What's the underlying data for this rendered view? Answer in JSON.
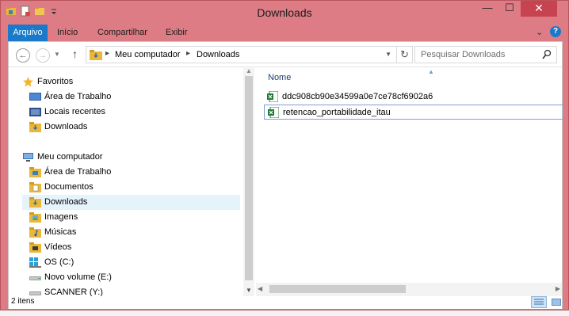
{
  "window": {
    "title": "Downloads",
    "controls": {
      "minimize": "—",
      "maximize": "☐",
      "close": "✕"
    }
  },
  "ribbon": {
    "tabs": [
      {
        "label": "Arquivo"
      },
      {
        "label": "Início"
      },
      {
        "label": "Compartilhar"
      },
      {
        "label": "Exibir"
      }
    ],
    "help": "?"
  },
  "address": {
    "segments": [
      "Meu computador",
      "Downloads"
    ],
    "search_placeholder": "Pesquisar Downloads"
  },
  "nav": {
    "items": [
      {
        "label": "Favoritos",
        "icon": "star-icon"
      },
      {
        "label": "Área de Trabalho",
        "icon": "desktop-icon"
      },
      {
        "label": "Locais recentes",
        "icon": "recent-places-icon"
      },
      {
        "label": "Downloads",
        "icon": "downloads-folder-icon"
      },
      {
        "label": "Meu computador",
        "icon": "computer-icon"
      },
      {
        "label": "Área de Trabalho",
        "icon": "desktop-folder-icon"
      },
      {
        "label": "Documentos",
        "icon": "documents-folder-icon"
      },
      {
        "label": "Downloads",
        "icon": "downloads-folder-icon",
        "selected": true
      },
      {
        "label": "Imagens",
        "icon": "pictures-folder-icon"
      },
      {
        "label": "Músicas",
        "icon": "music-folder-icon"
      },
      {
        "label": "Vídeos",
        "icon": "videos-folder-icon"
      },
      {
        "label": "OS (C:)",
        "icon": "windows-drive-icon"
      },
      {
        "label": "Novo volume (E:)",
        "icon": "drive-icon"
      },
      {
        "label": "SCANNER (Y:)",
        "icon": "drive-icon"
      }
    ]
  },
  "files": {
    "column_name": "Nome",
    "items": [
      {
        "name": "ddc908cb90e34599a0e7ce78cf6902a6",
        "icon": "excel-file-icon"
      },
      {
        "name": "retencao_portabilidade_itau",
        "icon": "excel-file-icon",
        "selected": true
      }
    ]
  },
  "status": {
    "item_count": "2 itens"
  }
}
